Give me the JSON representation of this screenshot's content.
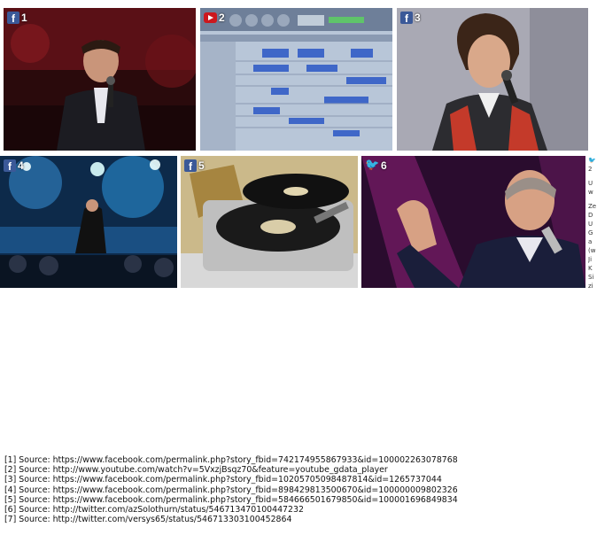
{
  "tiles": [
    {
      "index": "1",
      "network": "facebook",
      "icon": "facebook-icon"
    },
    {
      "index": "2",
      "network": "youtube",
      "icon": "youtube-play-icon"
    },
    {
      "index": "3",
      "network": "facebook",
      "icon": "facebook-icon"
    },
    {
      "index": "4",
      "network": "facebook",
      "icon": "facebook-icon"
    },
    {
      "index": "5",
      "network": "facebook",
      "icon": "facebook-icon"
    },
    {
      "index": "6",
      "network": "twitter",
      "icon": "twitter-bird-icon"
    }
  ],
  "side_panel": {
    "icon": "twitter-bird-icon",
    "lines": [
      "2",
      "U",
      "w",
      "Ze",
      "D",
      "U",
      "G",
      "a",
      "(w",
      "Ji",
      "K",
      "Si",
      "zi"
    ]
  },
  "sources": [
    "[1] Source: https://www.facebook.com/permalink.php?story_fbid=742174955867933&id=100002263078768",
    "[2] Source: http://www.youtube.com/watch?v=5VxzjBsqz70&feature=youtube_gdata_player",
    "[3] Source: https://www.facebook.com/permalink.php?story_fbid=10205705098487814&id=1265737044",
    "[4] Source: https://www.facebook.com/permalink.php?story_fbid=898429813500670&id=100000009802326",
    "[5] Source: https://www.facebook.com/permalink.php?story_fbid=584666501679850&id=100001696849834",
    "[6] Source: http://twitter.com/azSolothurn/status/546713470100447232",
    "[7] Source: http://twitter.com/versys65/status/546713303100452864"
  ]
}
